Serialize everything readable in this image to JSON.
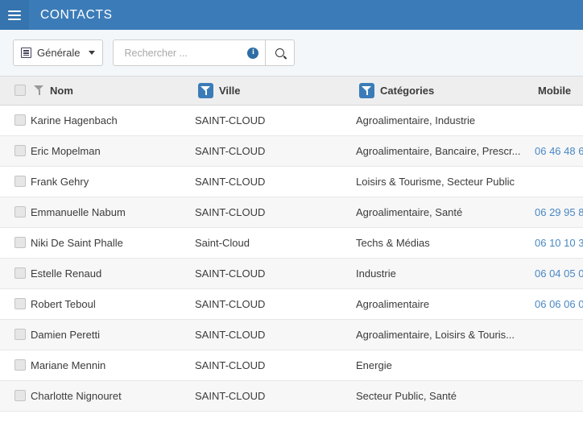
{
  "appbar": {
    "menu_icon": "hamburger-icon",
    "title": "CONTACTS"
  },
  "toolbar": {
    "view_selector": {
      "icon": "list-view-icon",
      "label": "Générale",
      "caret": "chevron-down-icon"
    },
    "search": {
      "placeholder": "Rechercher ...",
      "value": "",
      "info_icon": "info-icon",
      "info_glyph": "i",
      "search_icon": "search-icon"
    }
  },
  "grid": {
    "select_all": "",
    "columns": [
      {
        "key": "nom",
        "label": "Nom",
        "filter": "inactive"
      },
      {
        "key": "ville",
        "label": "Ville",
        "filter": "active"
      },
      {
        "key": "cat",
        "label": "Catégories",
        "filter": "active"
      },
      {
        "key": "mob",
        "label": "Mobile",
        "filter": "none"
      }
    ],
    "rows": [
      {
        "nom": "Karine Hagenbach",
        "ville": "SAINT-CLOUD",
        "cat": "Agroalimentaire, Industrie",
        "mob": ""
      },
      {
        "nom": "Eric Mopelman",
        "ville": "SAINT-CLOUD",
        "cat": "Agroalimentaire, Bancaire, Prescr...",
        "mob": "06 46 48 6"
      },
      {
        "nom": "Frank Gehry",
        "ville": "SAINT-CLOUD",
        "cat": "Loisirs & Tourisme, Secteur Public",
        "mob": ""
      },
      {
        "nom": "Emmanuelle Nabum",
        "ville": "SAINT-CLOUD",
        "cat": "Agroalimentaire, Santé",
        "mob": "06 29 95 8"
      },
      {
        "nom": "Niki De Saint Phalle",
        "ville": "Saint-Cloud",
        "cat": "Techs & Médias",
        "mob": "06 10 10 3"
      },
      {
        "nom": "Estelle Renaud",
        "ville": "SAINT-CLOUD",
        "cat": "Industrie",
        "mob": "06 04 05 0"
      },
      {
        "nom": "Robert Teboul",
        "ville": "SAINT-CLOUD",
        "cat": "Agroalimentaire",
        "mob": "06 06 06 0"
      },
      {
        "nom": "Damien Peretti",
        "ville": "SAINT-CLOUD",
        "cat": "Agroalimentaire, Loisirs & Touris...",
        "mob": ""
      },
      {
        "nom": "Mariane Mennin",
        "ville": "SAINT-CLOUD",
        "cat": "Energie",
        "mob": ""
      },
      {
        "nom": "Charlotte Nignouret",
        "ville": "SAINT-CLOUD",
        "cat": "Secteur Public, Santé",
        "mob": ""
      }
    ]
  },
  "colors": {
    "appbar": "#3b7cb8",
    "menu_block": "#3574ae",
    "toolbar_bg": "#f4f7fa",
    "header_bg": "#eeeeee",
    "row_alt": "#f7f7f7",
    "link": "#4a87c4"
  }
}
